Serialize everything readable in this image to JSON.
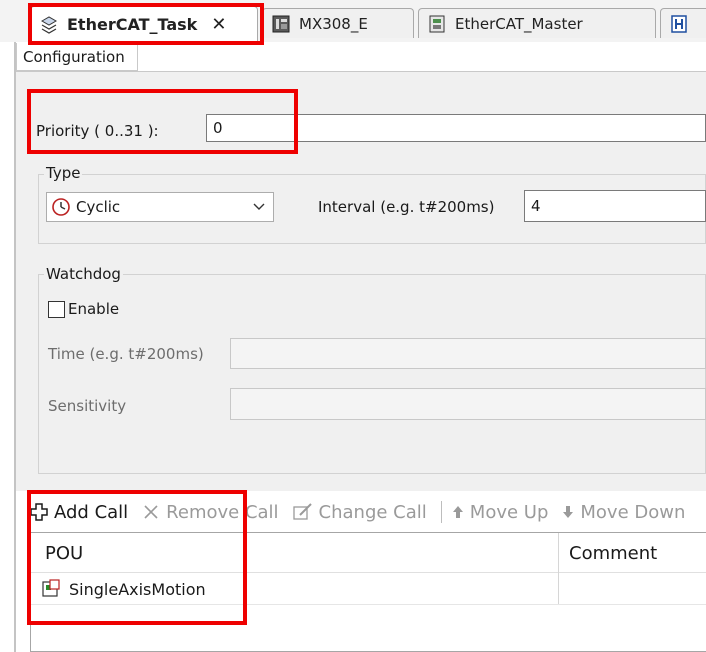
{
  "tabs": [
    {
      "label": "EtherCAT_Task",
      "icon": "task-config-icon",
      "active": true,
      "close": "✕"
    },
    {
      "label": "MX308_E",
      "icon": "device-icon",
      "active": false
    },
    {
      "label": "EtherCAT_Master",
      "icon": "master-device-icon",
      "active": false
    },
    {
      "label": "",
      "icon": "pou-icon",
      "active": false
    }
  ],
  "subtab": {
    "label": "Configuration"
  },
  "priority": {
    "label": "Priority ( 0..31 ):",
    "value": "0"
  },
  "type": {
    "group_label": "Type",
    "selected": "Cyclic",
    "icon": "clock-icon",
    "interval_label": "Interval (e.g. t#200ms)",
    "interval_value": "4"
  },
  "watchdog": {
    "group_label": "Watchdog",
    "enable_label": "Enable",
    "enabled": false,
    "time_label": "Time (e.g. t#200ms)",
    "time_value": "",
    "sensitivity_label": "Sensitivity",
    "sensitivity_value": ""
  },
  "toolbar": {
    "add_call": "Add Call",
    "remove_call": "Remove Call",
    "change_call": "Change Call",
    "move_up": "Move Up",
    "move_down": "Move Down"
  },
  "table": {
    "columns": [
      "POU",
      "Comment"
    ],
    "rows": [
      {
        "pou": "SingleAxisMotion",
        "comment": ""
      }
    ]
  },
  "colors": {
    "highlight": "#ee0000",
    "panel_bg": "#f0f0f0"
  }
}
